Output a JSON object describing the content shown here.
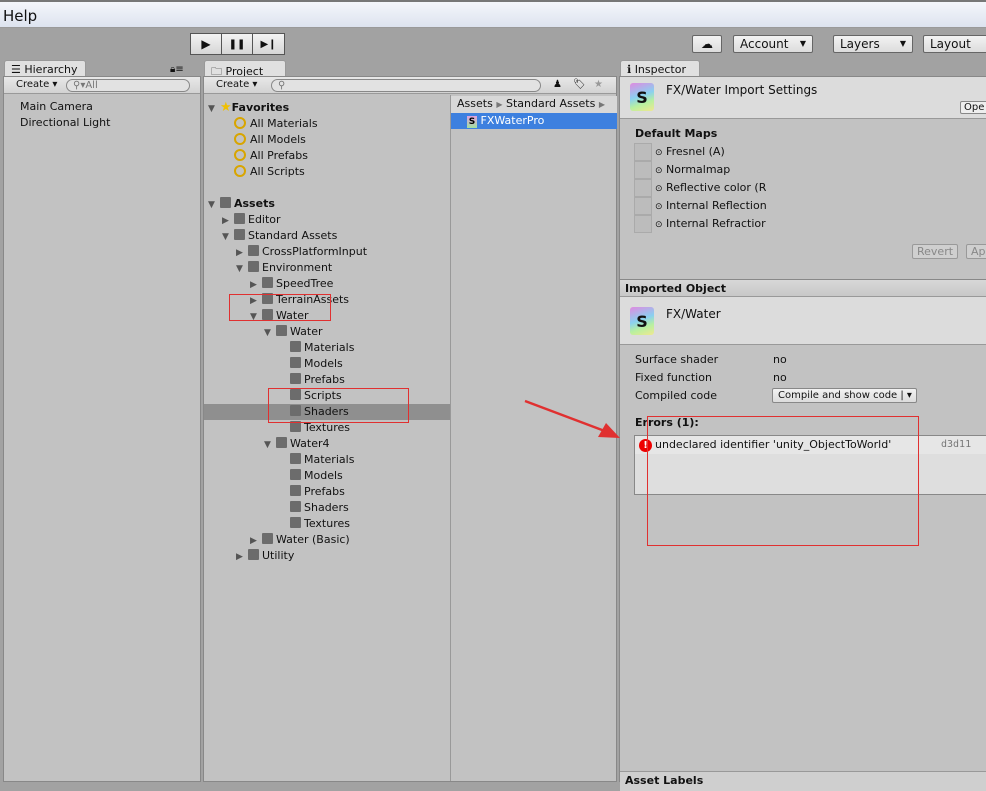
{
  "menu": {
    "help": "Help"
  },
  "toolbar": {
    "play": "▶",
    "pause": "❚❚",
    "step": "▶❙",
    "account": "Account",
    "layers": "Layers",
    "layout": "Layout"
  },
  "hierarchy": {
    "tab": "Hierarchy",
    "create": "Create",
    "search_placeholder": "All",
    "items": [
      "Main Camera",
      "Directional Light"
    ]
  },
  "project": {
    "tab": "Project",
    "create": "Create",
    "breadcrumb": [
      "Assets",
      "Standard Assets"
    ],
    "selected_file": "FXWaterPro",
    "tree": [
      {
        "label": "Favorites",
        "level": 0,
        "type": "star",
        "open": true,
        "bold": true
      },
      {
        "label": "All Materials",
        "level": 1,
        "type": "search"
      },
      {
        "label": "All Models",
        "level": 1,
        "type": "search"
      },
      {
        "label": "All Prefabs",
        "level": 1,
        "type": "search"
      },
      {
        "label": "All Scripts",
        "level": 1,
        "type": "search"
      },
      {
        "label": "",
        "level": 0,
        "type": "blank"
      },
      {
        "label": "Assets",
        "level": 0,
        "type": "folder",
        "open": true,
        "bold": true
      },
      {
        "label": "Editor",
        "level": 1,
        "type": "folder",
        "open": false
      },
      {
        "label": "Standard Assets",
        "level": 1,
        "type": "folder",
        "open": true
      },
      {
        "label": "CrossPlatformInput",
        "level": 2,
        "type": "folder",
        "open": false
      },
      {
        "label": "Environment",
        "level": 2,
        "type": "folder",
        "open": true
      },
      {
        "label": "SpeedTree",
        "level": 3,
        "type": "folder",
        "open": false
      },
      {
        "label": "TerrainAssets",
        "level": 3,
        "type": "folder",
        "open": false
      },
      {
        "label": "Water",
        "level": 3,
        "type": "folder",
        "open": true
      },
      {
        "label": "Water",
        "level": 4,
        "type": "folder",
        "open": true
      },
      {
        "label": "Materials",
        "level": 5,
        "type": "folder"
      },
      {
        "label": "Models",
        "level": 5,
        "type": "folder"
      },
      {
        "label": "Prefabs",
        "level": 5,
        "type": "folder"
      },
      {
        "label": "Scripts",
        "level": 5,
        "type": "folder"
      },
      {
        "label": "Shaders",
        "level": 5,
        "type": "folder",
        "selected": true
      },
      {
        "label": "Textures",
        "level": 5,
        "type": "folder"
      },
      {
        "label": "Water4",
        "level": 4,
        "type": "folder",
        "open": true
      },
      {
        "label": "Materials",
        "level": 5,
        "type": "folder"
      },
      {
        "label": "Models",
        "level": 5,
        "type": "folder"
      },
      {
        "label": "Prefabs",
        "level": 5,
        "type": "folder"
      },
      {
        "label": "Shaders",
        "level": 5,
        "type": "folder"
      },
      {
        "label": "Textures",
        "level": 5,
        "type": "folder"
      },
      {
        "label": "Water (Basic)",
        "level": 3,
        "type": "folder",
        "open": false
      },
      {
        "label": "Utility",
        "level": 2,
        "type": "folder",
        "open": false
      }
    ]
  },
  "inspector": {
    "tab": "Inspector",
    "title": "FX/Water Import Settings",
    "open": "Ope",
    "default_maps_label": "Default Maps",
    "maps": [
      "Fresnel (A)",
      "Normalmap",
      "Reflective color (R",
      "Internal Reflection",
      "Internal Refractior"
    ],
    "revert": "Revert",
    "apply": "Ap",
    "imported_object": "Imported Object",
    "shader_name": "FX/Water",
    "props": [
      {
        "label": "Surface shader",
        "value": "no"
      },
      {
        "label": "Fixed function",
        "value": "no"
      },
      {
        "label": "Compiled code",
        "value": "Compile and show code | ▾"
      }
    ],
    "errors_label": "Errors (1):",
    "error": {
      "message": "undeclared identifier 'unity_ObjectToWorld'",
      "platform": "d3d11"
    },
    "asset_labels": "Asset Labels"
  },
  "colors": {
    "selection": "#3d80df",
    "annotation": "#e03030"
  }
}
